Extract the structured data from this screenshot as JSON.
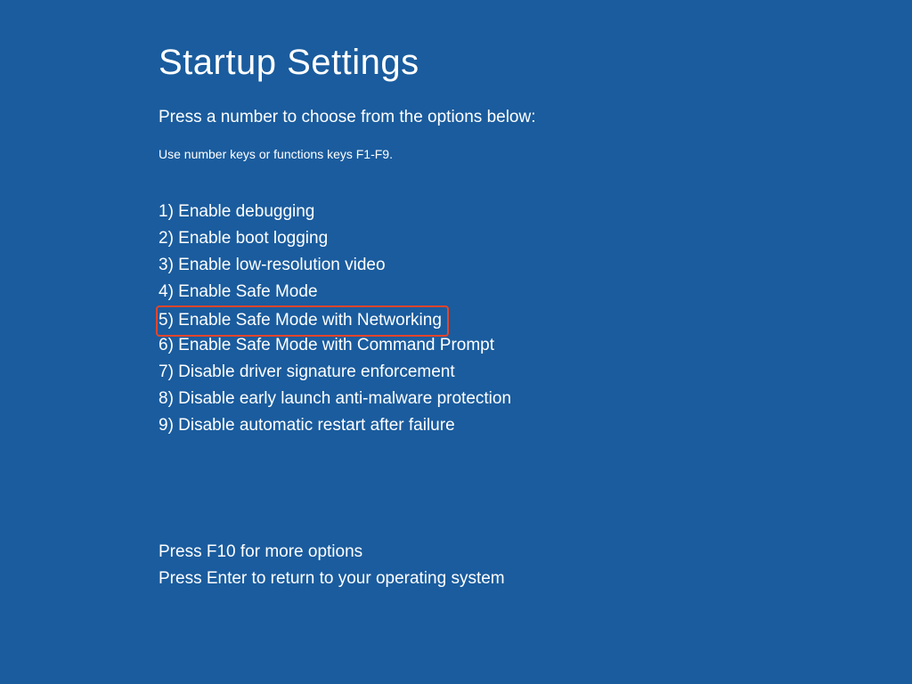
{
  "title": "Startup Settings",
  "subtitle": "Press a number to choose from the options below:",
  "hint": "Use number keys or functions keys F1-F9.",
  "options": [
    "1) Enable debugging",
    "2) Enable boot logging",
    "3) Enable low-resolution video",
    "4) Enable Safe Mode",
    "5) Enable Safe Mode with Networking",
    "6) Enable Safe Mode with Command Prompt",
    "7) Disable driver signature enforcement",
    "8) Disable early launch anti-malware protection",
    "9) Disable automatic restart after failure"
  ],
  "footer": {
    "more_options": "Press F10 for more options",
    "return": "Press Enter to return to your operating system"
  },
  "highlighted_index": 4
}
